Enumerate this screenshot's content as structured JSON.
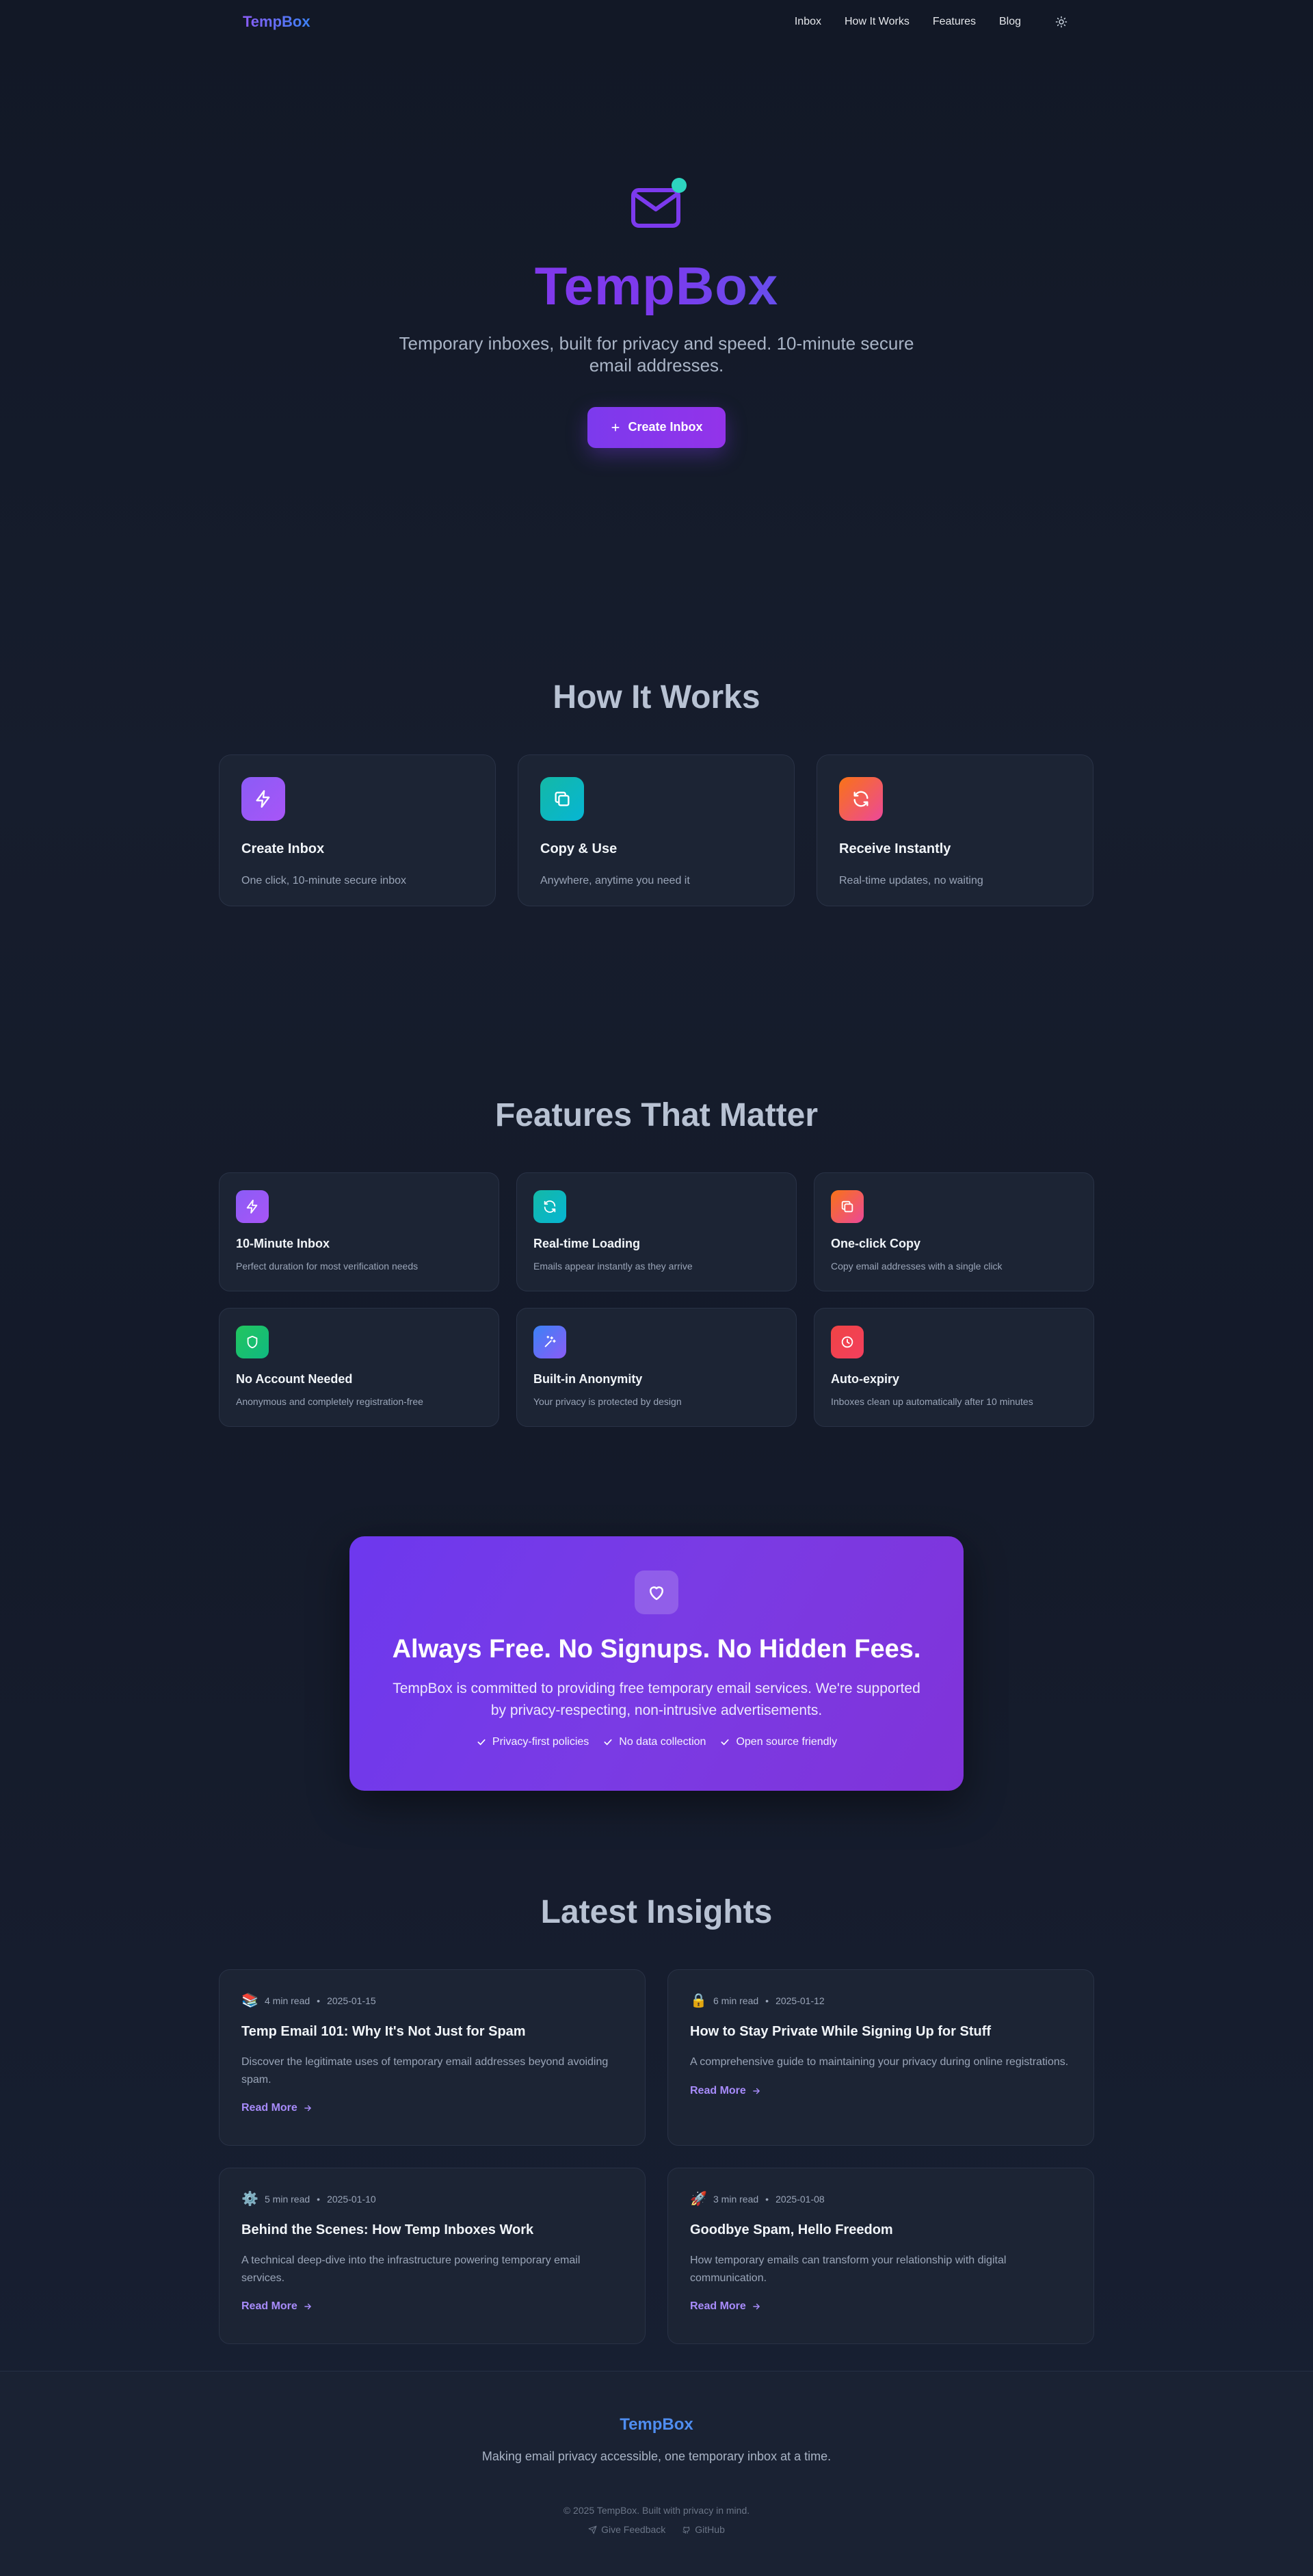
{
  "nav": {
    "brand": "TempBox",
    "links": [
      "Inbox",
      "How It Works",
      "Features",
      "Blog"
    ]
  },
  "hero": {
    "title": "TempBox",
    "subtitle": "Temporary inboxes, built for privacy and speed. 10-minute secure email addresses.",
    "button": "Create Inbox"
  },
  "how": {
    "title": "How It Works",
    "cards": [
      {
        "title": "Create Inbox",
        "text": "One click, 10-minute secure inbox",
        "icon": "lightning-icon",
        "color": "#8b5cf6"
      },
      {
        "title": "Copy & Use",
        "text": "Anywhere, anytime you need it",
        "icon": "copy-icon",
        "color": "#14b8a6"
      },
      {
        "title": "Receive Instantly",
        "text": "Real-time updates, no waiting",
        "icon": "refresh-icon",
        "color": "#f97316"
      }
    ]
  },
  "features": {
    "title": "Features That Matter",
    "cards": [
      {
        "title": "10-Minute Inbox",
        "text": "Perfect duration for most verification needs",
        "icon": "lightning-icon",
        "color": "#8b5cf6"
      },
      {
        "title": "Real-time Loading",
        "text": "Emails appear instantly as they arrive",
        "icon": "refresh-icon",
        "color": "#14b8a6"
      },
      {
        "title": "One-click Copy",
        "text": "Copy email addresses with a single click",
        "icon": "copy-icon",
        "color": "#f97316"
      },
      {
        "title": "No Account Needed",
        "text": "Anonymous and completely registration-free",
        "icon": "shield-icon",
        "color": "#22c55e"
      },
      {
        "title": "Built-in Anonymity",
        "text": "Your privacy is protected by design",
        "icon": "sparkle-icon",
        "color": "#6366f1"
      },
      {
        "title": "Auto-expiry",
        "text": "Inboxes clean up automatically after 10 minutes",
        "icon": "clock-icon",
        "color": "#f43f5e"
      }
    ]
  },
  "cta": {
    "title": "Always Free. No Signups. No Hidden Fees.",
    "text": "TempBox is committed to providing free temporary email services. We're supported by privacy-respecting, non-intrusive advertisements.",
    "badges": [
      "Privacy-first policies",
      "No data collection",
      "Open source friendly"
    ]
  },
  "insights": {
    "title": "Latest Insights",
    "posts": [
      {
        "emoji": "📚",
        "read": "4 min read",
        "date": "2025-01-15",
        "title": "Temp Email 101: Why It's Not Just for Spam",
        "excerpt": "Discover the legitimate uses of temporary email addresses beyond avoiding spam.",
        "link": "Read More"
      },
      {
        "emoji": "🔒",
        "read": "6 min read",
        "date": "2025-01-12",
        "title": "How to Stay Private While Signing Up for Stuff",
        "excerpt": "A comprehensive guide to maintaining your privacy during online registrations.",
        "link": "Read More"
      },
      {
        "emoji": "⚙️",
        "read": "5 min read",
        "date": "2025-01-10",
        "title": "Behind the Scenes: How Temp Inboxes Work",
        "excerpt": "A technical deep-dive into the infrastructure powering temporary email services.",
        "link": "Read More"
      },
      {
        "emoji": "🚀",
        "read": "3 min read",
        "date": "2025-01-08",
        "title": "Goodbye Spam, Hello Freedom",
        "excerpt": "How temporary emails can transform your relationship with digital communication.",
        "link": "Read More"
      }
    ]
  },
  "footer": {
    "brand": "TempBox",
    "tagline": "Making email privacy accessible, one temporary inbox at a time.",
    "copyright": "© 2025 TempBox. Built with privacy in mind.",
    "feedback": "Give Feedback",
    "github": "GitHub"
  }
}
